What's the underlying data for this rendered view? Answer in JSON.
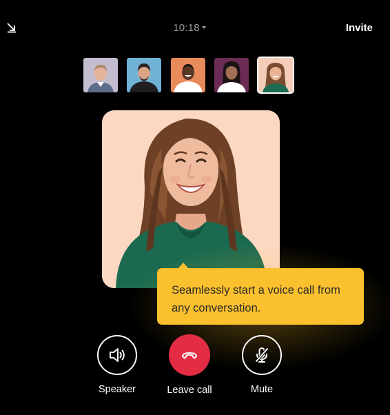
{
  "header": {
    "minimize_icon": "minimize-arrow-icon",
    "timer": "10:18",
    "invite_label": "Invite"
  },
  "participants": [
    {
      "name_icon": "participant-avatar",
      "bg": "#cfc8d8"
    },
    {
      "name_icon": "participant-avatar",
      "bg": "#6fb2d6"
    },
    {
      "name_icon": "participant-avatar",
      "bg": "#e88a5a"
    },
    {
      "name_icon": "participant-avatar",
      "bg": "#6a2c55"
    },
    {
      "name_icon": "participant-avatar",
      "bg": "#f4cdb8",
      "selected": true
    }
  ],
  "tooltip": {
    "text": "Seamlessly start a voice call from any conversation."
  },
  "controls": {
    "speaker_label": "Speaker",
    "leave_label": "Leave call",
    "mute_label": "Mute"
  },
  "colors": {
    "background": "#000000",
    "tooltip": "#fbc02d",
    "leave_button": "#e42d45",
    "video_bg": "#fcd8c2"
  }
}
